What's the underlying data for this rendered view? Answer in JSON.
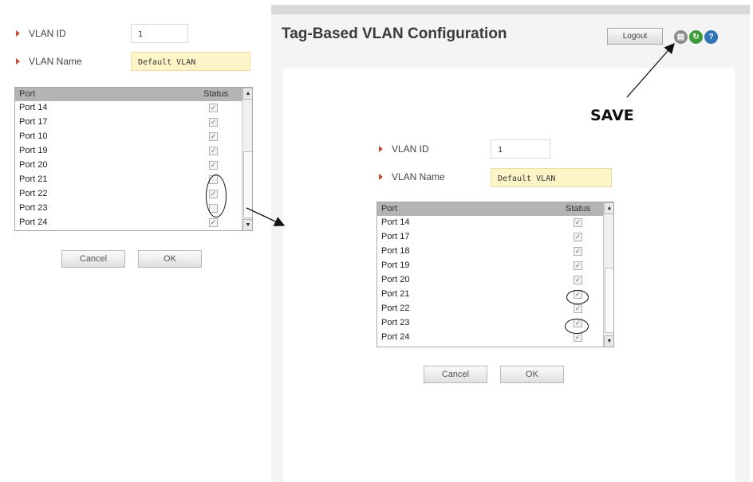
{
  "left_form": {
    "vlan_id_label": "VLAN ID",
    "vlan_id_value": "1",
    "vlan_name_label": "VLAN Name",
    "vlan_name_value": "Default VLAN",
    "table": {
      "col_port": "Port",
      "col_status": "Status",
      "rows": [
        {
          "port": "Port 14",
          "checked": true
        },
        {
          "port": "Port 17",
          "checked": true
        },
        {
          "port": "Port 10",
          "checked": true
        },
        {
          "port": "Port 19",
          "checked": true
        },
        {
          "port": "Port 20",
          "checked": true
        },
        {
          "port": "Port 21",
          "checked": false
        },
        {
          "port": "Port 22",
          "checked": true
        },
        {
          "port": "Port 23",
          "checked": false
        },
        {
          "port": "Port 24",
          "checked": true
        }
      ]
    },
    "cancel_label": "Cancel",
    "ok_label": "OK"
  },
  "header": {
    "title": "Tag-Based VLAN Configuration",
    "logout_label": "Logout",
    "icons": [
      "save-icon",
      "refresh-icon",
      "help-icon"
    ]
  },
  "annotation": {
    "save_label": "SAVE"
  },
  "right_form": {
    "vlan_id_label": "VLAN ID",
    "vlan_id_value": "1",
    "vlan_name_label": "VLAN Name",
    "vlan_name_value": "Default VLAN",
    "table": {
      "col_port": "Port",
      "col_status": "Status",
      "rows": [
        {
          "port": "Port 14",
          "checked": true
        },
        {
          "port": "Port 17",
          "checked": true
        },
        {
          "port": "Port 18",
          "checked": true
        },
        {
          "port": "Port 19",
          "checked": true
        },
        {
          "port": "Port 20",
          "checked": true
        },
        {
          "port": "Port 21",
          "checked": true
        },
        {
          "port": "Port 22",
          "checked": true
        },
        {
          "port": "Port 23",
          "checked": true
        },
        {
          "port": "Port 24",
          "checked": true
        }
      ]
    },
    "cancel_label": "Cancel",
    "ok_label": "OK"
  },
  "colors": {
    "bullet": "#c64a38",
    "name_field_bg": "#fdf4c8",
    "table_header_bg": "#b4b4b4"
  }
}
